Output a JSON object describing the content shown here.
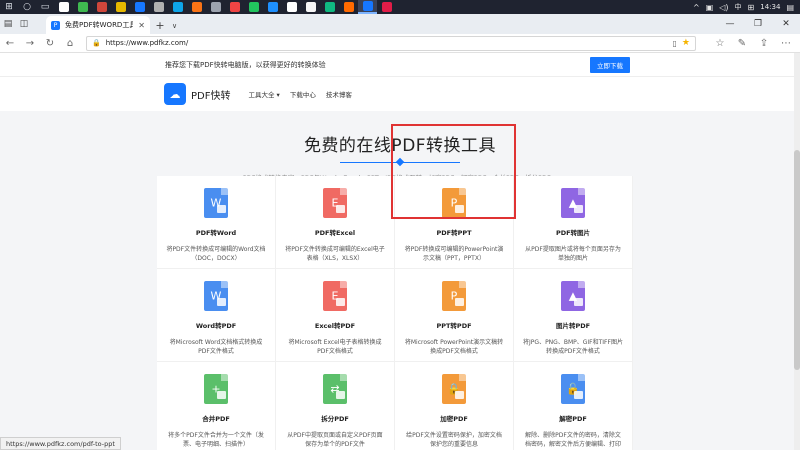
{
  "taskbar": {
    "clock": "14:34",
    "ime": "中",
    "apps": [
      {
        "name": "app-1",
        "color": "#ffffff"
      },
      {
        "name": "app-2",
        "color": "#3fb950"
      },
      {
        "name": "app-3",
        "color": "#d0463b"
      },
      {
        "name": "app-4",
        "color": "#e6b800"
      },
      {
        "name": "app-5",
        "color": "#1677ff"
      },
      {
        "name": "app-6",
        "color": "#b0b0b0"
      },
      {
        "name": "app-7",
        "color": "#0ea5e9"
      },
      {
        "name": "app-8",
        "color": "#f97316"
      },
      {
        "name": "app-9",
        "color": "#9ca3af"
      },
      {
        "name": "app-10",
        "color": "#ef4444"
      },
      {
        "name": "app-11",
        "color": "#22c55e"
      },
      {
        "name": "app-12",
        "color": "#1e90ff"
      },
      {
        "name": "app-13",
        "color": "#ffffff"
      },
      {
        "name": "app-14",
        "color": "#f5f5f5"
      },
      {
        "name": "app-15",
        "color": "#10b981"
      },
      {
        "name": "app-16",
        "color": "#ff6a00"
      },
      {
        "name": "app-17",
        "color": "#1677ff"
      },
      {
        "name": "app-18",
        "color": "#e11d48"
      }
    ]
  },
  "browser": {
    "tab_title": "免费PDF转WORD工具|F",
    "url": "https://www.pdfkz.com/",
    "status_url": "https://www.pdfkz.com/pdf-to-ppt"
  },
  "banner": {
    "text": "推荐您下载PDF快转电脑版，以获得更好的转换体验",
    "button": "立即下载"
  },
  "header": {
    "logo": "PDF快转",
    "menu": [
      "工具大全 ▾",
      "下载中心",
      "技术博客"
    ]
  },
  "hero": {
    "title": "免费的在线PDF转换工具",
    "subtitle": "PDF格式转换专家：PDF与Word、Excel、PPT、JPG格式互转，加密PDF，解密PDF，合并PDF，拆分PDF。"
  },
  "tools": [
    {
      "title": "PDF转Word",
      "desc": "将PDF文件转换成可编辑的Word文档（DOC，DOCX）",
      "color": "#4a8ef0",
      "glyph": "W"
    },
    {
      "title": "PDF转Excel",
      "desc": "将PDF文件转换成可编辑的Excel电子表格（XLS，XLSX）",
      "color": "#f06a63",
      "glyph": "E"
    },
    {
      "title": "PDF转PPT",
      "desc": "将PDF转换成可编辑的PowerPoint演示文稿（PPT，PPTX）",
      "color": "#f39a3a",
      "glyph": "P"
    },
    {
      "title": "PDF转图片",
      "desc": "从PDF提取图片或将每个页面另存为单独的图片",
      "color": "#8f66e3",
      "glyph": "▲"
    },
    {
      "title": "Word转PDF",
      "desc": "将Microsoft Word文档格式转换成PDF文件格式",
      "color": "#4a8ef0",
      "glyph": "W"
    },
    {
      "title": "Excel转PDF",
      "desc": "将Microsoft Excel电子表格转换成PDF文档格式",
      "color": "#f06a63",
      "glyph": "E"
    },
    {
      "title": "PPT转PDF",
      "desc": "将Microsoft PowerPoint演示文稿转换成PDF文档格式",
      "color": "#f39a3a",
      "glyph": "P"
    },
    {
      "title": "图片转PDF",
      "desc": "将JPG、PNG、BMP、GIF和TIFF图片转换成PDF文件格式",
      "color": "#8f66e3",
      "glyph": "▲"
    },
    {
      "title": "合并PDF",
      "desc": "将多个PDF文件合并为一个文件（发票、电子明细、扫描件）",
      "color": "#5bbf6a",
      "glyph": "+"
    },
    {
      "title": "拆分PDF",
      "desc": "从PDF中提取页面或自定义PDF页面保存为单个的PDF文件",
      "color": "#5bbf6a",
      "glyph": "⇄"
    },
    {
      "title": "加密PDF",
      "desc": "给PDF文件设置密码保护，加密文档保护您的重要信息",
      "color": "#f39a3a",
      "glyph": "🔒"
    },
    {
      "title": "解密PDF",
      "desc": "解除、删除PDF文件的密码，清除文档密码，解密文件后方便编辑、打印",
      "color": "#4a8ef0",
      "glyph": "🔓"
    }
  ]
}
